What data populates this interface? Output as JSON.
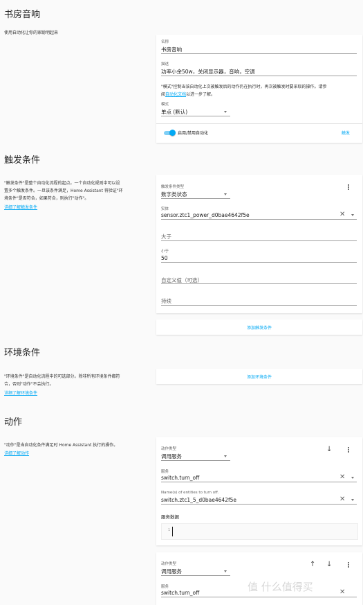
{
  "automation": {
    "title": "书房音响",
    "description": "使用自动化让你的家聪明起来",
    "name_label": "名称",
    "name_value": "书房音响",
    "desc_label": "描述",
    "desc_value": "功率小余50w，关闭显示器，音响，空调",
    "mode_note_a": "\"模式\"控制当该自动化上次被触发后的动作仍在执行时，再次被触发时要采取的操作。请参",
    "mode_note_b": "阅",
    "mode_note_link": "自动化文档",
    "mode_note_c": "以进一步了解。",
    "mode_label": "模式",
    "mode_value": "单点 (默认)",
    "toggle_label": "启用/禁用自动化",
    "trigger_button": "触发",
    "enabled": true
  },
  "triggers": {
    "title": "触发条件",
    "desc_lines": [
      "\"触发条件\"是整个自动化流程的起点。一个自动化规则中可以设",
      "置多个触发条件。一旦该条件满足，Home Assistant 将验证\"环",
      "境条件\"是否符合，如果符合，则执行\"动作\"。"
    ],
    "learn_more": "详细了解触发条件",
    "type_label": "触发条件类型",
    "type_value": "数字类状态",
    "entity_label": "实体",
    "entity_value": "sensor.ztc1_power_d0bae4642f5e",
    "above_placeholder": "大于",
    "below_label": "小于",
    "below_value": "50",
    "template_placeholder": "自定义值（可选）",
    "duration_placeholder": "持续",
    "add_button": "添加触发条件"
  },
  "conditions": {
    "title": "环境条件",
    "desc_lines": [
      "\"环境条件\"是自动化流程中的可选部分。除非所有环境条件都符",
      "合，否则\"动作\"不会执行。"
    ],
    "learn_more": "详细了解环境条件",
    "add_button": "添加环境条件"
  },
  "actions": {
    "title": "动作",
    "desc": "\"动作\"是当自动化条件满足时 Home Assistant 执行的操作。",
    "learn_more": "详细了解动作",
    "items": [
      {
        "type_label": "动作类型",
        "type_value": "调用服务",
        "service_label": "服务",
        "service_value": "switch.turn_off",
        "entity_label": "Name(s) of entities to turn off.",
        "entity_value": "switch.ztc1_5_d0bae4642f5e",
        "data_label": "服务数据",
        "line_number": "1"
      },
      {
        "type_label": "动作类型",
        "type_value": "调用服务",
        "service_label": "服务",
        "service_value": "switch.turn_off"
      }
    ]
  },
  "watermark": "值 什么值得买",
  "colors": {
    "accent": "#03a9f4",
    "background": "#fafafa",
    "card": "#ffffff"
  }
}
